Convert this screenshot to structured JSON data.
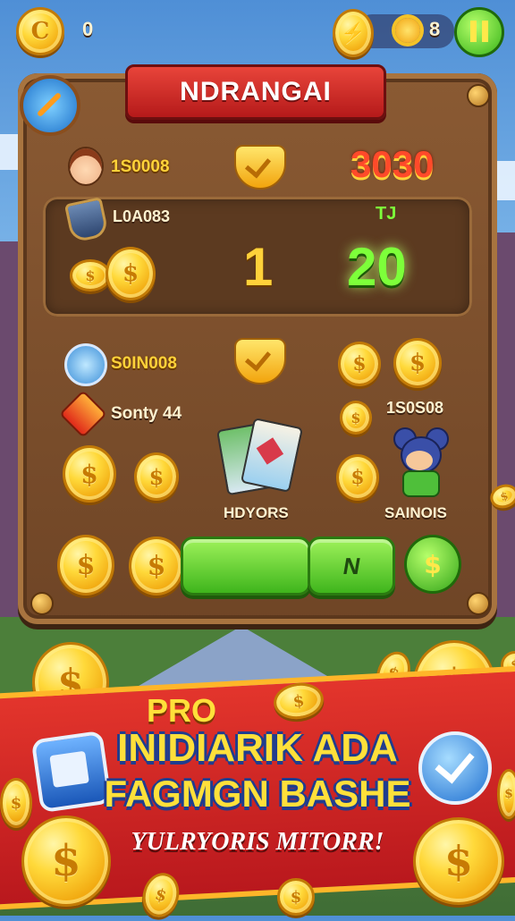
{
  "topbar": {
    "coin_count": "0",
    "gem_count": "8",
    "pause_icon": "pause-icon"
  },
  "board": {
    "title": "NDRANGAI",
    "row1": {
      "label": "1S0008",
      "score": "3030"
    },
    "panel": {
      "label": "L0A083",
      "tag": "TJ",
      "left_value": "1",
      "right_value": "20"
    },
    "row3": {
      "label": "S0IN008"
    },
    "row4": {
      "label": "Sonty 44",
      "right_label": "1S0S08"
    },
    "cards_label": "HDYORS",
    "character_label": "SAINOIS",
    "button_label": "N"
  },
  "promo": {
    "pro_label": "PRO",
    "line1": "INIDIARIK ADA",
    "line2": "FAGMGN BASHE",
    "line3": "YULRYORIS MITORR!"
  },
  "colors": {
    "accent_red": "#d8262a",
    "gold": "#ffd23a",
    "green": "#4fcf23",
    "wood": "#7b5232"
  },
  "icons": [
    "coin-icon",
    "sun-gem-icon",
    "pause-icon",
    "compass-icon",
    "checkmark-icon",
    "shield-icon",
    "cards-icon",
    "map-icon"
  ]
}
